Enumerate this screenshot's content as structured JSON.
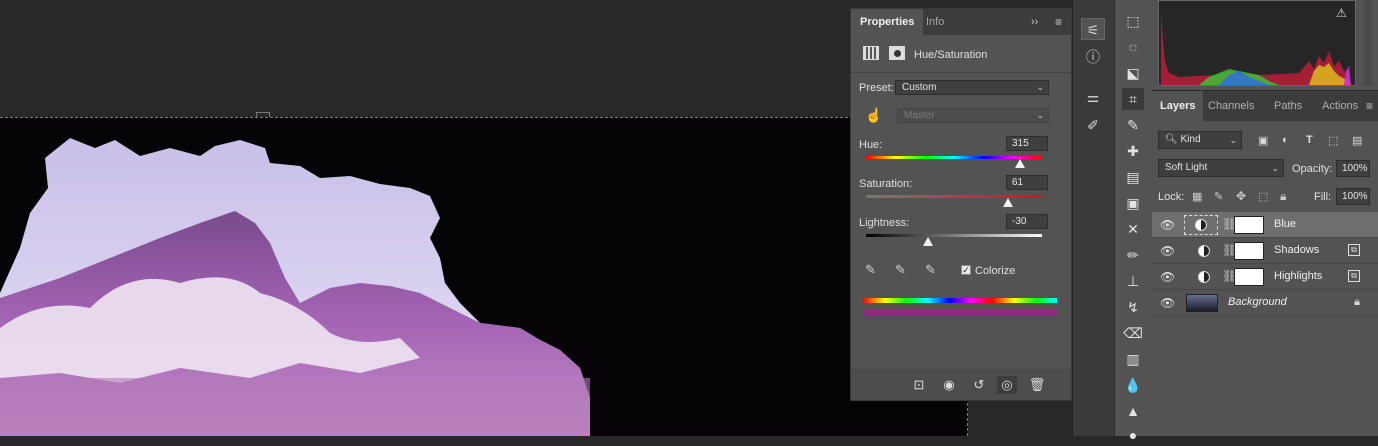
{
  "properties": {
    "tabs": [
      "Properties",
      "Info"
    ],
    "title": "Hue/Saturation",
    "preset_label": "Preset:",
    "preset_value": "Custom",
    "channel_value": "Master",
    "hue_label": "Hue:",
    "hue_value": "315",
    "saturation_label": "Saturation:",
    "saturation_value": "61",
    "lightness_label": "Lightness:",
    "lightness_value": "-30",
    "colorize_label": "Colorize",
    "colorize_checked": true,
    "hue_fraction": 0.875,
    "saturation_fraction": 0.805,
    "lightness_fraction": 0.35
  },
  "layers_panel": {
    "tabs": [
      "Layers",
      "Channels",
      "Paths",
      "Actions"
    ],
    "filter_kind": "Kind",
    "blend_mode": "Soft Light",
    "opacity_label": "Opacity:",
    "opacity_value": "100%",
    "lock_label": "Lock:",
    "fill_label": "Fill:",
    "fill_value": "100%",
    "layers": [
      {
        "name": "Blue",
        "type": "adjustment",
        "selected": true
      },
      {
        "name": "Shadows",
        "type": "adjustment",
        "selected": false
      },
      {
        "name": "Highlights",
        "type": "adjustment",
        "selected": false
      },
      {
        "name": "Background",
        "type": "image",
        "selected": false
      }
    ]
  },
  "colors": {
    "panel_bg": "#535353",
    "tab_bar": "#3c3c3c",
    "canvas_bg": "#000000",
    "workspace_bg": "#282828"
  }
}
